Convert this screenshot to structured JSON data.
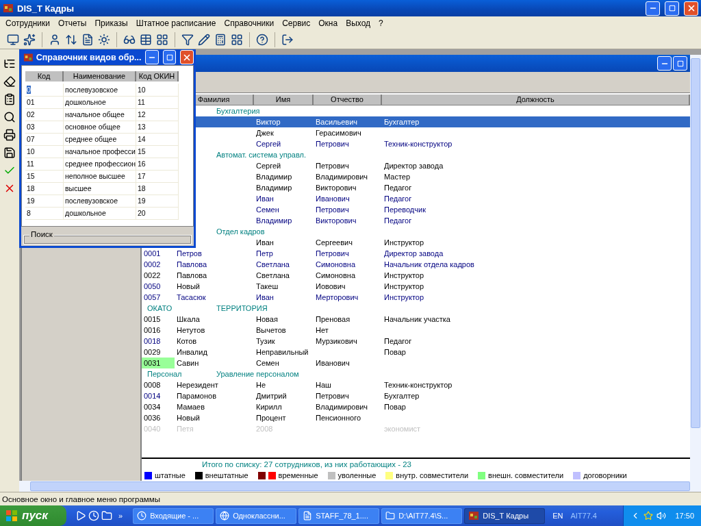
{
  "window": {
    "title": "DIS_T Кадры"
  },
  "menu": [
    "Сотрудники",
    "Отчеты",
    "Приказы",
    "Штатное расписание",
    "Справочники",
    "Сервис",
    "Окна",
    "Выход",
    "?"
  ],
  "employee_list": {
    "columns": [
      "Фамилия",
      "Имя",
      "Отчество",
      "Должность"
    ],
    "rows": [
      {
        "kind": "group",
        "title": "Бухгалтерия"
      },
      {
        "kind": "employee",
        "name": "Виктор",
        "patronymic": "Васильевич",
        "position": "Бухгалтер",
        "selected": true
      },
      {
        "kind": "employee",
        "name": "Джек",
        "patronymic": "Герасимович",
        "color": "#000000",
        "selected": false
      },
      {
        "kind": "employee",
        "name": "Сергей",
        "patronymic": "Петрович",
        "position": "Техник-конструктор",
        "color": "#000080",
        "selected": false
      },
      {
        "kind": "group",
        "title": "Автомат. система управл."
      },
      {
        "kind": "employee",
        "name": "Сергей",
        "patronymic": "Петрович",
        "position": "Директор завода",
        "color": "#000000",
        "selected": false
      },
      {
        "kind": "employee",
        "name": "Владимир",
        "patronymic": "Владимирович",
        "position": "Мастер",
        "color": "#000000",
        "selected": false
      },
      {
        "kind": "employee",
        "name": "Владимир",
        "patronymic": "Викторович",
        "position": "Педагог",
        "color": "#000000",
        "selected": false
      },
      {
        "kind": "employee",
        "name": "Иван",
        "patronymic": "Иванович",
        "position": "Педагог",
        "color": "#000080",
        "selected": false
      },
      {
        "kind": "employee",
        "name": "Семен",
        "patronymic": "Петрович",
        "position": "Переводчик",
        "color": "#000080",
        "selected": false
      },
      {
        "kind": "employee",
        "name": "Владимир",
        "patronymic": "Викторович",
        "position": "Педагог",
        "color": "#000080",
        "selected": false
      },
      {
        "kind": "group",
        "title": "Отдел кадров"
      },
      {
        "kind": "employee",
        "name": "Иван",
        "patronymic": "Сергеевич",
        "position": "Инструктор",
        "color": "#000000",
        "selected": false
      },
      {
        "kind": "employee",
        "code": {
          "text": "0001",
          "staff": true,
          "highlighted": false
        },
        "surname": "Петров",
        "name": "Петр",
        "patronymic": "Петрович",
        "position": "Директор завода",
        "color": "#000080",
        "selected": false
      },
      {
        "kind": "employee",
        "code": {
          "text": "0002",
          "staff": true,
          "highlighted": false
        },
        "surname": "Павлова",
        "name": "Светлана",
        "patronymic": "Симоновна",
        "position": "Начальник отдела кадров",
        "color": "#000080",
        "selected": false
      },
      {
        "kind": "employee",
        "code": {
          "text": "0022",
          "staff": false,
          "highlighted": false
        },
        "surname": "Павлова",
        "name": "Светлана",
        "patronymic": "Симоновна",
        "position": "Инструктор",
        "color": "#000000",
        "selected": false
      },
      {
        "kind": "employee",
        "code": {
          "text": "0050",
          "staff": true,
          "highlighted": false
        },
        "surname": "Новый",
        "name": "Такеш",
        "patronymic": "Иовович",
        "position": "Инструктор",
        "color": "#000000",
        "selected": false
      },
      {
        "kind": "employee",
        "code": {
          "text": "0057",
          "staff": true,
          "highlighted": false
        },
        "surname": "Тасасюк",
        "name": "Иван",
        "patronymic": "Мерторович",
        "position": "Инструктор",
        "color": "#000080",
        "selected": false
      },
      {
        "kind": "group",
        "code": "ОКАТО",
        "title": "ТЕРРИТОРИЯ"
      },
      {
        "kind": "employee",
        "code": {
          "text": "0015",
          "staff": false,
          "highlighted": false
        },
        "surname": "Шкала",
        "name": "Новая",
        "patronymic": "Преновая",
        "position": "Начальник участка",
        "color": "#000000",
        "selected": false
      },
      {
        "kind": "employee",
        "code": {
          "text": "0016",
          "staff": false,
          "highlighted": false
        },
        "surname": "Нетутов",
        "name": "Вычетов",
        "patronymic": "Нет",
        "color": "#000000",
        "selected": false
      },
      {
        "kind": "employee",
        "code": {
          "text": "0018",
          "staff": true,
          "highlighted": false
        },
        "surname": "Котов",
        "name": "Тузик",
        "patronymic": "Мурзикович",
        "position": "Педагог",
        "color": "#000000",
        "selected": false
      },
      {
        "kind": "employee",
        "code": {
          "text": "0029",
          "staff": false,
          "highlighted": false
        },
        "surname": "Инвалид",
        "name": "Неправильный",
        "position": "Повар",
        "color": "#000000",
        "selected": false
      },
      {
        "kind": "employee",
        "code": {
          "text": "0031",
          "staff": false,
          "highlighted": true
        },
        "surname": "Савин",
        "name": "Семен",
        "patronymic": "Иванович",
        "color": "#000000",
        "selected": false
      },
      {
        "kind": "group",
        "code": "Персонал",
        "title": "Уравление персоналом"
      },
      {
        "kind": "employee",
        "code": {
          "text": "0008",
          "staff": false,
          "highlighted": false
        },
        "surname": "Нерезидент",
        "name": "Не",
        "patronymic": "Наш",
        "position": "Техник-конструктор",
        "color": "#000000",
        "selected": false
      },
      {
        "kind": "employee",
        "code": {
          "text": "0014",
          "staff": true,
          "highlighted": false
        },
        "surname": "Парамонов",
        "name": "Дмитрий",
        "patronymic": "Петрович",
        "position": "Бухгалтер",
        "color": "#000000",
        "selected": false
      },
      {
        "kind": "employee",
        "code": {
          "text": "0034",
          "staff": false,
          "highlighted": false
        },
        "surname": "Мамаев",
        "name": "Кирилл",
        "patronymic": "Владимирович",
        "position": "Повар",
        "color": "#000000",
        "selected": false
      },
      {
        "kind": "employee",
        "code": {
          "text": "0036",
          "staff": false,
          "highlighted": false
        },
        "surname": "Новый",
        "name": "Процент",
        "patronymic": "Пенсионного",
        "color": "#000000",
        "selected": false
      },
      {
        "kind": "employee",
        "code": {
          "text": "0040",
          "staff": false,
          "highlighted": false
        },
        "surname": "Петя",
        "name": "2008",
        "position": "экономист",
        "color": "#c0c0c0",
        "selected": false
      }
    ],
    "total": "Итого по списку: 27 сотрудников, из них работающих - 23",
    "legend": [
      {
        "label": "штатные",
        "swatches": [
          {
            "color": "#0000ff"
          }
        ]
      },
      {
        "label": "внештатные",
        "swatches": [
          {
            "color": "#000000"
          }
        ]
      },
      {
        "label": "временные",
        "swatches": [
          {
            "color": "#800000"
          },
          {
            "color": "#ff0000"
          }
        ]
      },
      {
        "label": "уволенные",
        "swatches": [
          {
            "color": "#c0c0c0"
          }
        ]
      },
      {
        "label": "внутр. совместители",
        "swatches": [
          {
            "color": "#ffff80"
          }
        ]
      },
      {
        "label": "внешн. совместители",
        "swatches": [
          {
            "color": "#80ff80"
          }
        ]
      },
      {
        "label": "договорники",
        "swatches": [
          {
            "color": "#c0c0ff"
          }
        ]
      }
    ]
  },
  "dialog": {
    "title": "Справочник видов обр...",
    "columns": [
      "Код",
      "Наименование",
      "Код ОКИН"
    ],
    "rows": [
      {
        "code": "0",
        "name": "послевузовское",
        "okin": "10",
        "selected": true
      },
      {
        "code": "01",
        "name": "дошкольное",
        "okin": "11",
        "selected": false
      },
      {
        "code": "02",
        "name": "начальное общее",
        "okin": "12",
        "selected": false
      },
      {
        "code": "03",
        "name": "основное общее",
        "okin": "13",
        "selected": false
      },
      {
        "code": "07",
        "name": "среднее общее",
        "okin": "14",
        "selected": false
      },
      {
        "code": "10",
        "name": "начальное професси",
        "okin": "15",
        "selected": false
      },
      {
        "code": "11",
        "name": "среднее профессион",
        "okin": "16",
        "selected": false
      },
      {
        "code": "15",
        "name": "неполное высшее",
        "okin": "17",
        "selected": false
      },
      {
        "code": "18",
        "name": "высшее",
        "okin": "18",
        "selected": false
      },
      {
        "code": "19",
        "name": "послевузовское",
        "okin": "19",
        "selected": false
      },
      {
        "code": "8",
        "name": "дошкольное",
        "okin": "20",
        "selected": false
      }
    ],
    "search_label": "Поиск"
  },
  "status_bar": "Основное окно и главное меню программы",
  "taskbar": {
    "start": "пуск",
    "more": "»",
    "tasks": [
      {
        "label": "Входящие - ...",
        "selected": false
      },
      {
        "label": "Одноклассни...",
        "selected": false
      },
      {
        "label": "STAFF_78_1....",
        "selected": false
      },
      {
        "label": "D:\\AIT77.4\\S...",
        "selected": false
      },
      {
        "label": "DIS_T Кадры",
        "selected": true
      }
    ],
    "language": "EN",
    "tray_label": "AIT77.4",
    "clock": "17:50"
  }
}
